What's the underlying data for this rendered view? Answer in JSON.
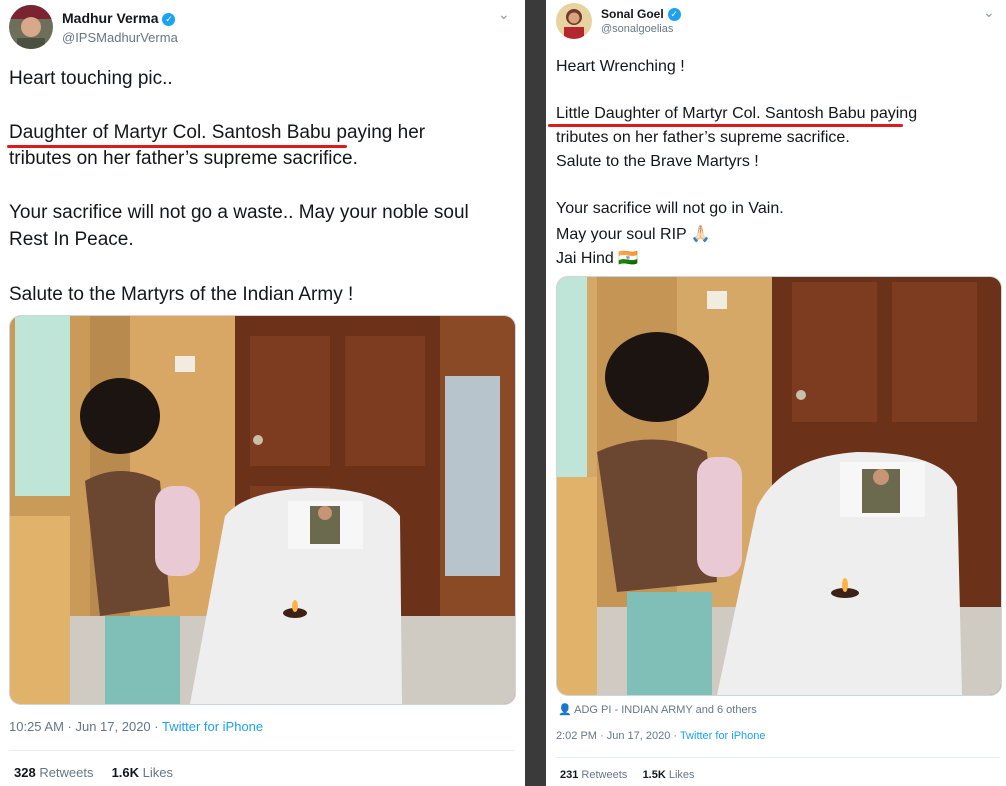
{
  "left_tweet": {
    "author_name": "Madhur Verma",
    "author_handle": "@IPSMadhurVerma",
    "lines": [
      "Heart touching pic..",
      "Daughter of Martyr Col. Santosh Babu paying her",
      "tributes on her father’s supreme sacrifice.",
      "Your sacrifice will not go a waste.. May your noble soul",
      "Rest In Peace.",
      "Salute to the Martyrs of the Indian Army !"
    ],
    "time": "10:25 AM · Jun 17, 2020 · ",
    "source": "Twitter for iPhone",
    "retweets_count": "328",
    "retweets_label": " Retweets",
    "likes_count": "1.6K",
    "likes_label": " Likes"
  },
  "right_tweet": {
    "author_name": "Sonal Goel",
    "author_handle": "@sonalgoelias",
    "lines": [
      "Heart Wrenching !",
      "Little Daughter of Martyr  Col. Santosh Babu paying",
      "tributes on her father’s supreme sacrifice.",
      "Salute to the Brave Martyrs !",
      "Your sacrifice will not go in Vain.",
      "May your soul RIP 🙏🏻",
      "Jai Hind 🇮🇳"
    ],
    "tagged": "ADG PI - INDIAN ARMY and 6 others",
    "time": "2:02 PM · Jun 17, 2020 · ",
    "source": "Twitter for iPhone",
    "retweets_count": "231",
    "retweets_label": " Retweets",
    "likes_count": "1.5K",
    "likes_label": " Likes"
  },
  "colors": {
    "underline": "#e0191b",
    "link": "#1da1f2",
    "muted": "#657786",
    "divider": "#3a3a3a"
  },
  "icons": [
    "verified-badge-icon",
    "chevron-down-icon",
    "person-icon"
  ]
}
